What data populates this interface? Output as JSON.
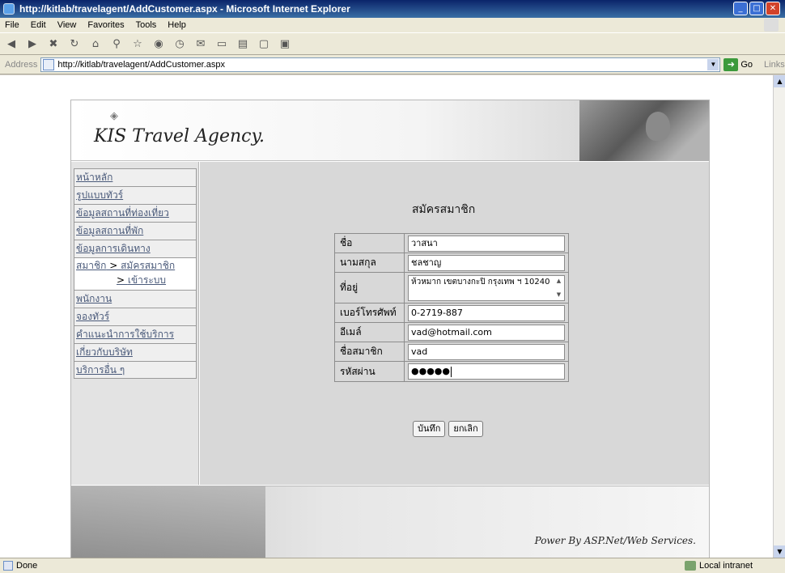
{
  "window": {
    "title": "http://kitlab/travelagent/AddCustomer.aspx - Microsoft Internet Explorer"
  },
  "menu": [
    "File",
    "Edit",
    "View",
    "Favorites",
    "Tools",
    "Help"
  ],
  "address": {
    "label": "Address",
    "url": "http://kitlab/travelagent/AddCustomer.aspx",
    "go": "Go",
    "links": "Links"
  },
  "site": {
    "logo": "KIS Travel Agency.",
    "nav": [
      {
        "label": "หน้าหลัก"
      },
      {
        "label": "รูปแบบทัวร์"
      },
      {
        "label": "ข้อมูลสถานที่ท่องเที่ยว"
      },
      {
        "label": "ข้อมูลสถานที่พัก"
      },
      {
        "label": "ข้อมูลการเดินทาง"
      },
      {
        "label": "สมาชิก",
        "sep": " > ",
        "child": "สมัครสมาชิก",
        "sub_prefix": "> ",
        "sub": "เข้าระบบ"
      },
      {
        "label": "พนักงาน"
      },
      {
        "label": "จองทัวร์"
      },
      {
        "label": "คำแนะนำการใช้บริการ"
      },
      {
        "label": "เกี่ยวกับบริษัท"
      },
      {
        "label": "บริการอื่น ๆ"
      }
    ],
    "footer": "Power By ASP.Net/Web Services."
  },
  "form": {
    "title": "สมัครสมาชิก",
    "fields": {
      "name": {
        "label": "ชื่อ",
        "value": "วาสนา"
      },
      "surname": {
        "label": "นามสกุล",
        "value": "ชลชาญ"
      },
      "address": {
        "label": "ที่อยู่",
        "value": "ห้วหมาก เขตบางกะปิ กรุงเทพ ฯ 10240"
      },
      "phone": {
        "label": "เบอร์โทรศัพท์",
        "value": "0-2719-887"
      },
      "email": {
        "label": "อีเมล์",
        "value": "vad@hotmail.com"
      },
      "username": {
        "label": "ชื่อสมาชิก",
        "value": "vad"
      },
      "password": {
        "label": "รหัสผ่าน",
        "value": "●●●●●"
      }
    },
    "save": "บันทึก",
    "cancel": "ยกเลิก"
  },
  "status": {
    "left": "Done",
    "zone": "Local intranet"
  }
}
